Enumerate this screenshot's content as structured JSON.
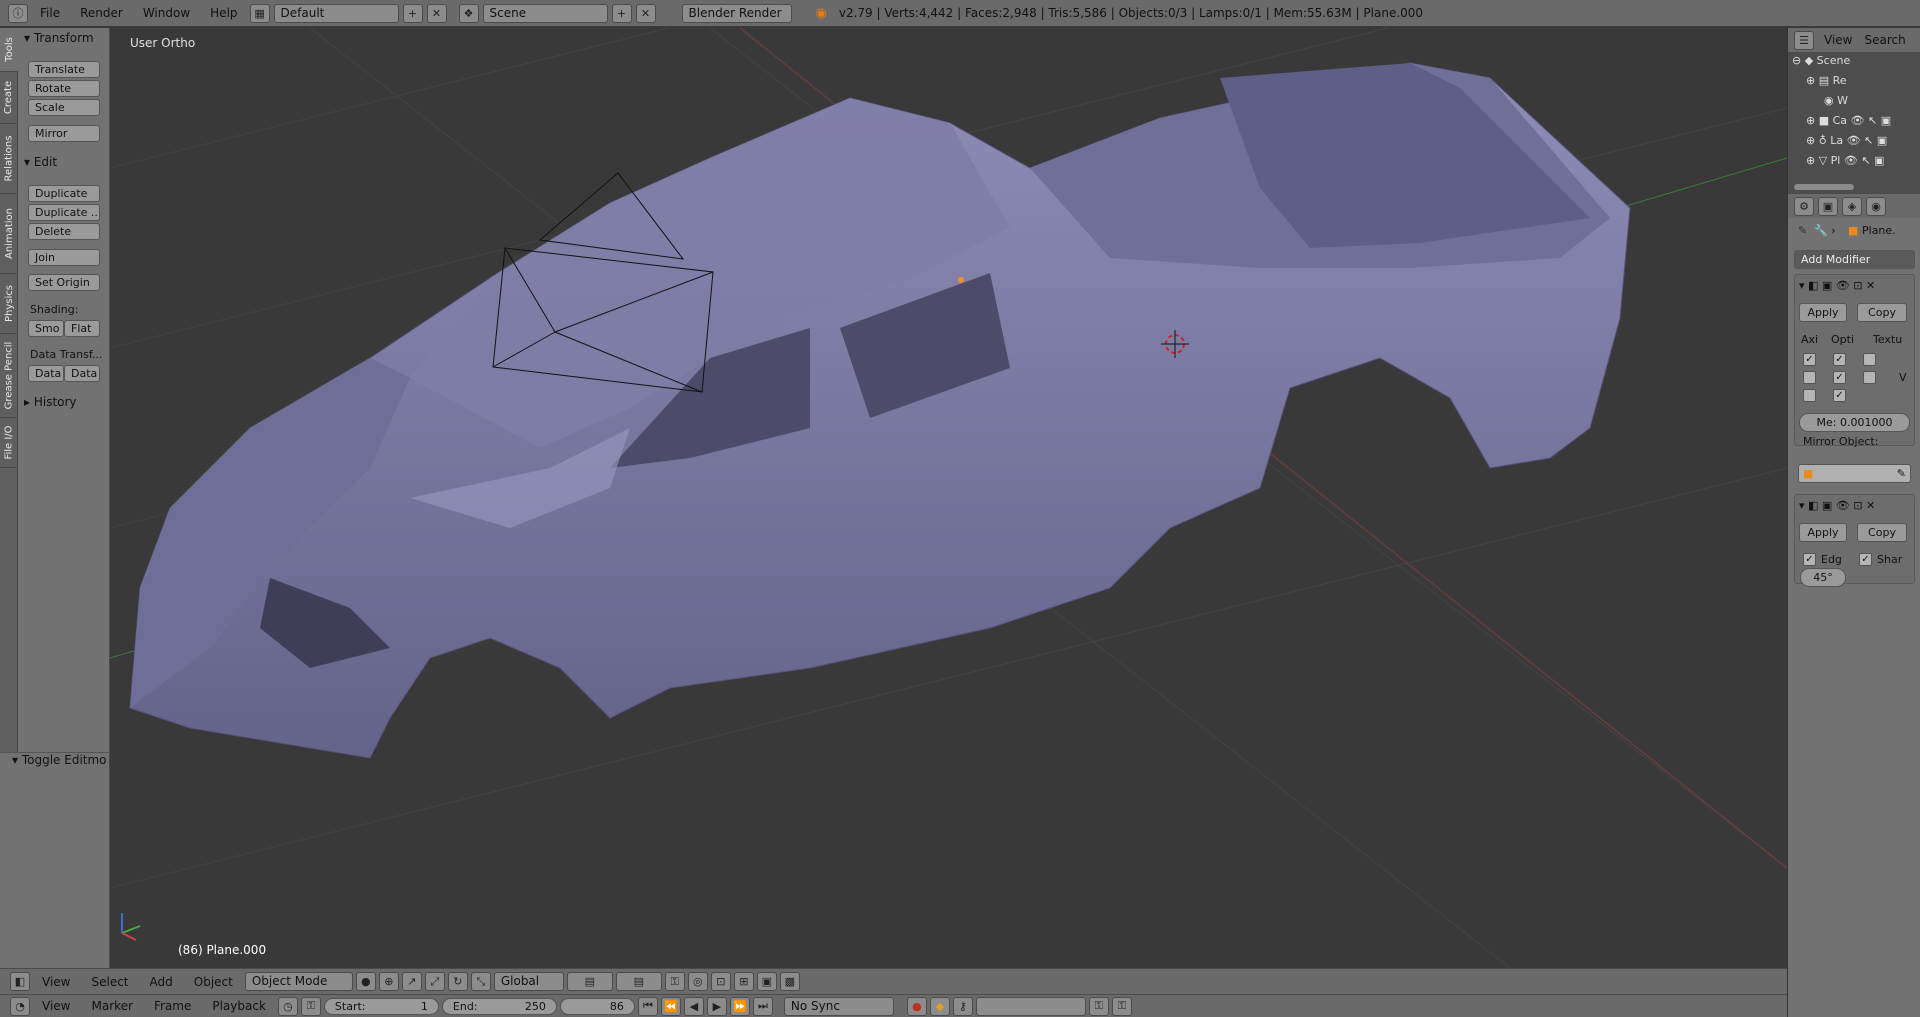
{
  "topbar": {
    "menus": [
      "File",
      "Render",
      "Window",
      "Help"
    ],
    "screen_layout": "Default",
    "scene": "Scene",
    "engine": "Blender Render",
    "stats": "v2.79 | Verts:4,442 | Faces:2,948 | Tris:5,586 | Objects:0/3 | Lamps:0/1 | Mem:55.63M | Plane.000"
  },
  "tabstrip": {
    "tabs": [
      "Tools",
      "Create",
      "Relations",
      "Animation",
      "Physics",
      "Grease Pencil",
      "File I/O"
    ]
  },
  "toolshelf": {
    "transform_header": "Transform",
    "translate": "Translate",
    "rotate": "Rotate",
    "scale": "Scale",
    "mirror": "Mirror",
    "edit_header": "Edit",
    "duplicate": "Duplicate",
    "duplicate_linked": "Duplicate ...",
    "delete": "Delete",
    "join": "Join",
    "set_origin": "Set Origin",
    "shading_label": "Shading:",
    "smooth": "Smo",
    "flat": "Flat",
    "data_transfer_label": "Data Transf...",
    "data1": "Data",
    "data2": "Data",
    "history_header": "History"
  },
  "redo_panel": {
    "title": "Toggle Editmo"
  },
  "viewport": {
    "view_name": "User Ortho",
    "object_info": "(86) Plane.000"
  },
  "viewport_header": {
    "menus": [
      "View",
      "Select",
      "Add",
      "Object"
    ],
    "mode": "Object Mode",
    "orientation": "Global"
  },
  "timeline": {
    "menus": [
      "View",
      "Marker",
      "Frame",
      "Playback"
    ],
    "start_label": "Start:",
    "start_value": "1",
    "end_label": "End:",
    "end_value": "250",
    "current_frame": "86",
    "sync": "No Sync"
  },
  "outliner": {
    "view": "View",
    "search": "Search",
    "rows": [
      "Scene",
      "Re",
      "W",
      "Ca",
      "La",
      "Pl"
    ]
  },
  "properties": {
    "object_name": "Plane.",
    "add_modifier": "Add Modifier",
    "mod1": {
      "apply": "Apply",
      "copy": "Copy",
      "col_axis": "Axi",
      "col_options": "Opti",
      "col_texture": "Textu",
      "v_label": "V",
      "merge": "Me: 0.001000",
      "mirror_object_label": "Mirror Object:"
    },
    "mod2": {
      "apply": "Apply",
      "copy": "Copy",
      "edge_label": "Edg",
      "sharp_label": "Shar",
      "angle": "45°"
    }
  }
}
